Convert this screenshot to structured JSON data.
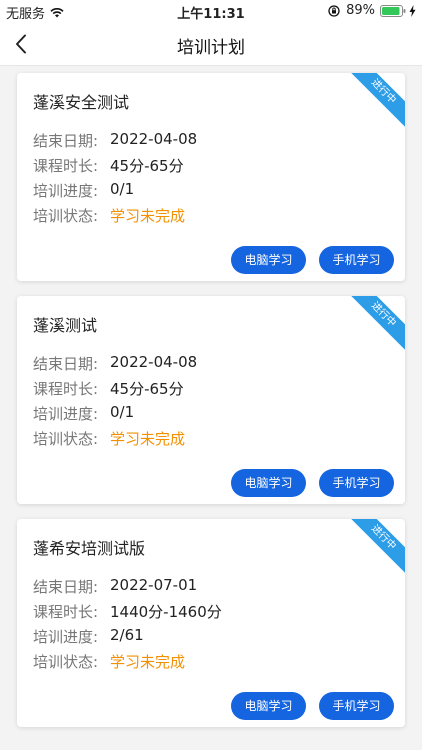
{
  "status_bar": {
    "carrier": "无服务",
    "time": "上午11:31",
    "battery": "89%"
  },
  "nav": {
    "title": "培训计划"
  },
  "labels": {
    "end_date": "结束日期:",
    "duration": "课程时长:",
    "progress": "培训进度:",
    "status": "培训状态:"
  },
  "cards": [
    {
      "title": "蓬溪安全测试",
      "ribbon": "进行中",
      "end_date": "2022-04-08",
      "duration": "45分-65分",
      "progress": "0/1",
      "status": "学习未完成",
      "pc_button": "电脑学习",
      "phone_button": "手机学习"
    },
    {
      "title": "蓬溪测试",
      "ribbon": "进行中",
      "end_date": "2022-04-08",
      "duration": "45分-65分",
      "progress": "0/1",
      "status": "学习未完成",
      "pc_button": "电脑学习",
      "phone_button": "手机学习"
    },
    {
      "title": "蓬希安培测试版",
      "ribbon": "进行中",
      "end_date": "2022-07-01",
      "duration": "1440分-1460分",
      "progress": "2/61",
      "status": "学习未完成",
      "pc_button": "电脑学习",
      "phone_button": "手机学习"
    }
  ],
  "colors": {
    "ribbon": "#2d9de8",
    "button": "#1565e0",
    "status_text": "#f29100"
  }
}
